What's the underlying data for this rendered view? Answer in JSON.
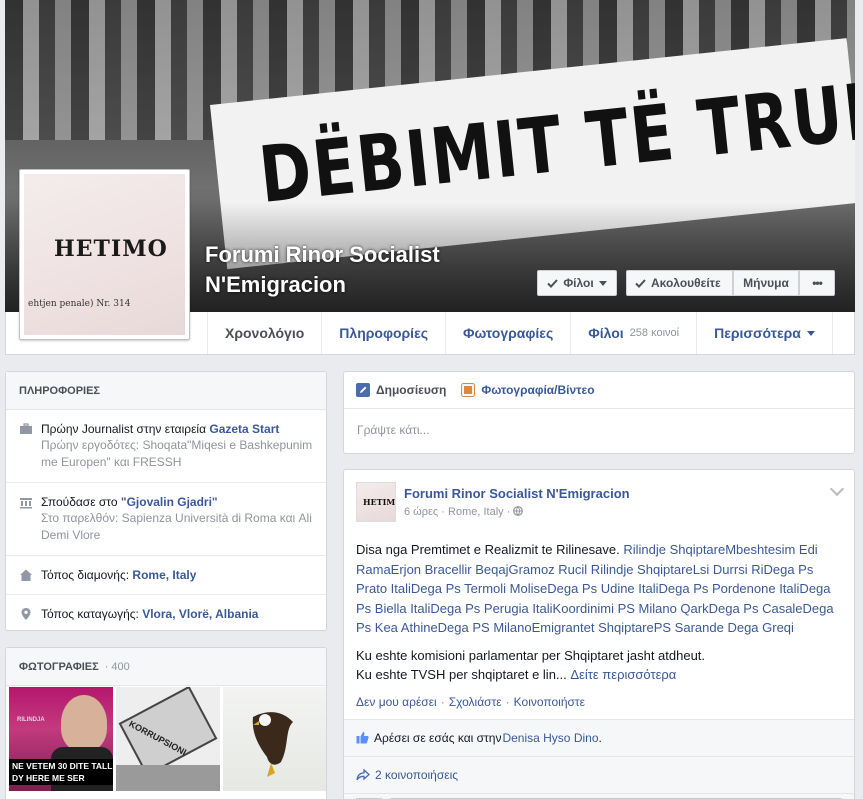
{
  "cover": {
    "banner_text": "DËBIMIT TË TRURIT !"
  },
  "page": {
    "name_line1": "Forumi Rinor Socialist",
    "name_line2": "N'Emigracion"
  },
  "profile_pic": {
    "text_big": "HETIMO",
    "text_small": "ehtjen penale) Nr. 314"
  },
  "actions": {
    "friends": "Φίλοι",
    "follow": "Ακολουθείτε",
    "message": "Μήνυμα",
    "more": "•••"
  },
  "nav": {
    "tabs": [
      {
        "label": "Χρονολόγιο"
      },
      {
        "label": "Πληροφορίες"
      },
      {
        "label": "Φωτογραφίες"
      },
      {
        "label": "Φίλοι",
        "count": "258 κοινοί"
      },
      {
        "label": "Περισσότερα"
      }
    ]
  },
  "info": {
    "title": "ΠΛΗΡΟΦΟΡΙΕΣ",
    "work_prefix": "Πρώην Journalist στην εταιρεία ",
    "work_company": "Gazeta Start",
    "work_sub": "Πρώην εργοδότες: Shoqata\"Miqesi e Bashkepunim me Europen\" και FRESSH",
    "edu_prefix": "Σπούδασε στο ",
    "edu_school": "\"Gjovalin Gjadri\"",
    "edu_sub": "Στο παρελθόν: Sapienza Università di Roma και Ali Demi Vlore",
    "home_prefix": "Τόπος διαμονής: ",
    "home_value": "Rome, Italy",
    "origin_prefix": "Τόπος καταγωγής: ",
    "origin_value": "Vlora, Vlorë, Albania"
  },
  "photos": {
    "title": "ΦΩΤΟΓΡΑΦΙΕΣ",
    "count": "400",
    "thumb1_caption_line1": "NE VETEM 30 DITE TALL",
    "thumb1_caption_line2": "DY HERE ME SER",
    "thumb1_logo": "RILINDJA",
    "thumb2_word": "KORRUPSIONI"
  },
  "composer": {
    "tab_post": "Δημοσίευση",
    "tab_photo": "Φωτογραφία/Βίντεο",
    "placeholder": "Γράψτε κάτι..."
  },
  "post": {
    "author": "Forumi Rinor Socialist N'Emigracion",
    "time": "6 ώρες",
    "location": "Rome, Italy",
    "avatar_text": "HETIMO",
    "text_start": "Disa nga Premtimet e Realizmit te Rilinesave. ",
    "tags": "Rilindje ShqiptareMbeshtesim Edi RamaErjon Bracellir BeqajGramoz Rucil Rilindje ShqiptareLsi Durrsi RiDega Ps Prato ItaliDega Ps Termoli MoliseDega Ps Udine ItaliDega Ps Pordenone ItaliDega Ps Biella ItaliDega Ps Perugia ItaliKoordinimi PS Milano QarkDega Ps CasaleDega Ps Kea AthineDega PS MilanoEmigrantet ShqiptarePS Sarande Dega Greqi",
    "line2": "Ku eshte komisioni parlamentar per Shqiptaret jasht atdheut.",
    "line3": "Ku eshte TVSH per shqiptaret e lin...",
    "see_more": "Δείτε περισσότερα",
    "action_unlike": "Δεν μου αρέσει",
    "action_comment": "Σχολιάστε",
    "action_share": "Κοινοποιήστε",
    "likes_prefix": "Αρέσει σε εσάς και στην ",
    "likes_name": "Denisa Hyso Dino",
    "likes_suffix": ".",
    "shares": "2 κοινοποιήσεις"
  }
}
